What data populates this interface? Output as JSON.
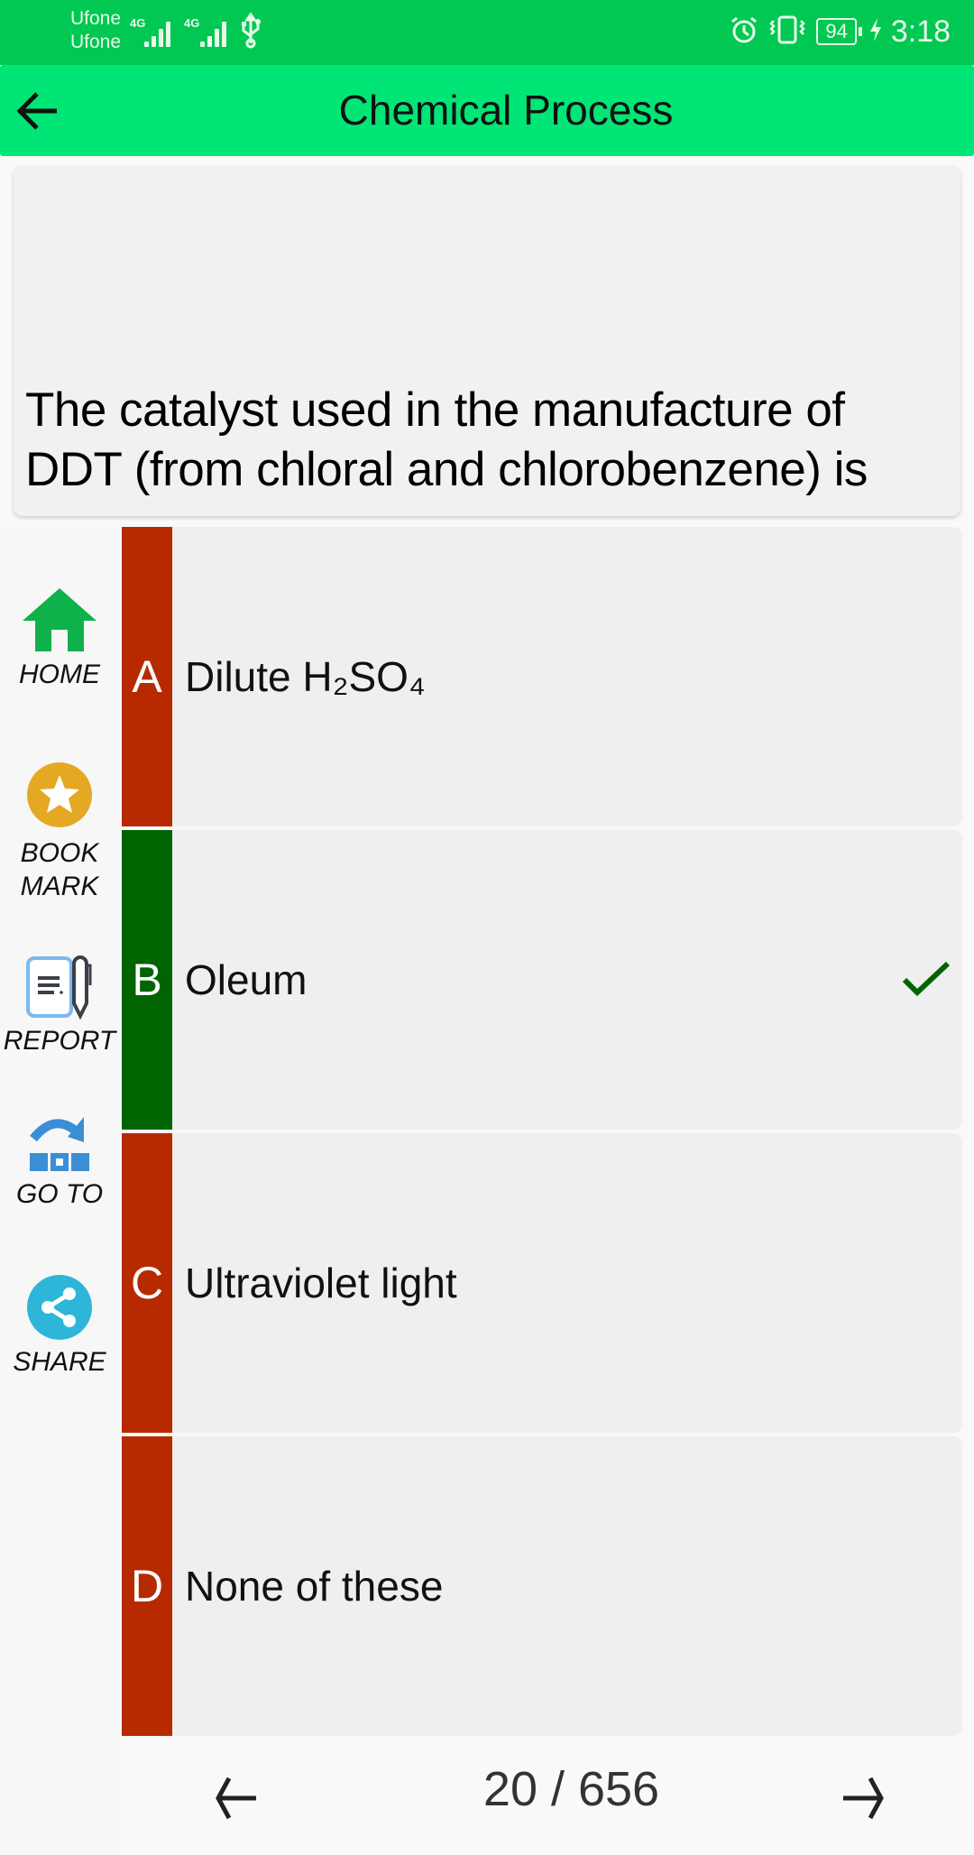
{
  "status_bar": {
    "carrier_1": "Ufone",
    "carrier_2": "Ufone",
    "network_1": "4G",
    "network_2": "4G",
    "battery": "94",
    "time": "3:18",
    "icons": [
      "signal-icon",
      "usb-icon",
      "alarm-icon",
      "vibrate-icon",
      "battery-icon",
      "charging-icon"
    ]
  },
  "app_bar": {
    "title": "Chemical Process",
    "back_icon": "arrow-left-icon"
  },
  "question": {
    "text": "The catalyst used in the manufacture of DDT (from chloral and chlorobenzene) is"
  },
  "sidebar": {
    "items": [
      {
        "label": "HOME",
        "icon": "home-icon"
      },
      {
        "label": "BOOK MARK",
        "line1": "BOOK",
        "line2": "MARK",
        "icon": "star-icon"
      },
      {
        "label": "REPORT",
        "icon": "report-icon"
      },
      {
        "label": "GO TO",
        "icon": "goto-icon"
      },
      {
        "label": "SHARE",
        "icon": "share-icon"
      }
    ]
  },
  "options": [
    {
      "letter": "A",
      "text": "Dilute H₂SO₄",
      "state": "wrong",
      "color": "#b72a00"
    },
    {
      "letter": "B",
      "text": "Oleum",
      "state": "correct",
      "color": "#006400"
    },
    {
      "letter": "C",
      "text": "Ultraviolet light",
      "state": "wrong",
      "color": "#b72a00"
    },
    {
      "letter": "D",
      "text": "None of these",
      "state": "wrong",
      "color": "#b72a00"
    }
  ],
  "pager": {
    "current": "20",
    "total": "656",
    "label": "20 / 656",
    "prev_icon": "arrow-left-icon",
    "next_icon": "arrow-right-icon"
  },
  "colors": {
    "status_bar": "#00c853",
    "app_bar": "#00e676",
    "wrong": "#b72a00",
    "correct": "#006400",
    "check": "#006400",
    "home_icon": "#0fb14a",
    "bookmark_icon": "#e5a823",
    "goto_icon": "#3a8fd6",
    "share_icon": "#2eb6d9"
  }
}
